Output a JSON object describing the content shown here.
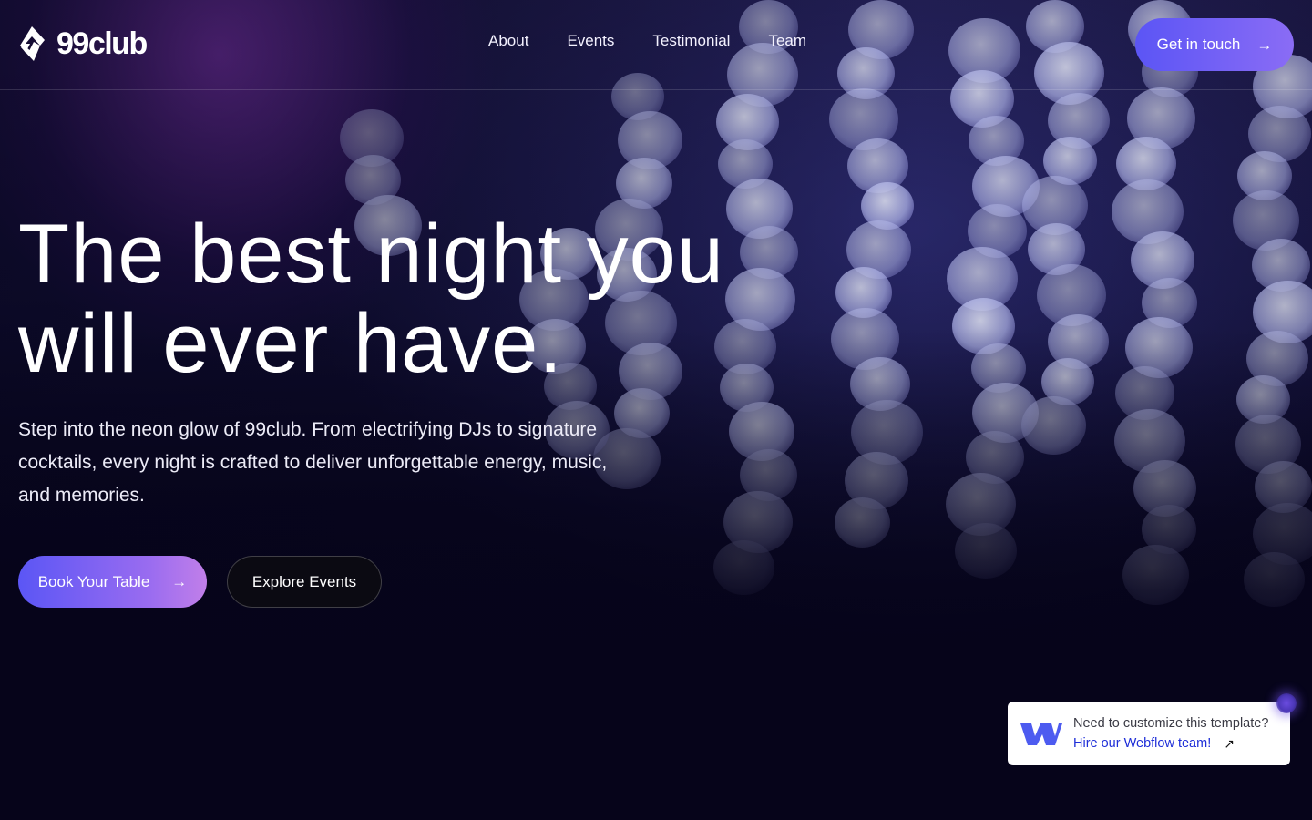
{
  "brand": {
    "name": "99club",
    "logo_icon": "diamond-bolt-logo"
  },
  "nav": {
    "items": [
      {
        "label": "About"
      },
      {
        "label": "Events"
      },
      {
        "label": "Testimonial"
      },
      {
        "label": "Team"
      }
    ],
    "cta_label": "Get in touch"
  },
  "hero": {
    "title_line1": "The best night you",
    "title_line2": "will ever have.",
    "subtitle": "Step into the neon glow of 99club. From electrifying DJs to signature cocktails, every night is crafted to deliver unforgettable energy, music, and memories.",
    "primary_label": "Book Your Table",
    "secondary_label": "Explore Events"
  },
  "promo": {
    "title": "Need to customize this template?",
    "link_label": "Hire our Webflow team!"
  },
  "colors": {
    "accent_start": "#5b56f5",
    "accent_end": "#c17fe9",
    "background": "#07051a",
    "link": "#1f2fd8"
  },
  "icons": [
    "arrow-right-icon",
    "external-link-icon",
    "webflow-logo"
  ]
}
